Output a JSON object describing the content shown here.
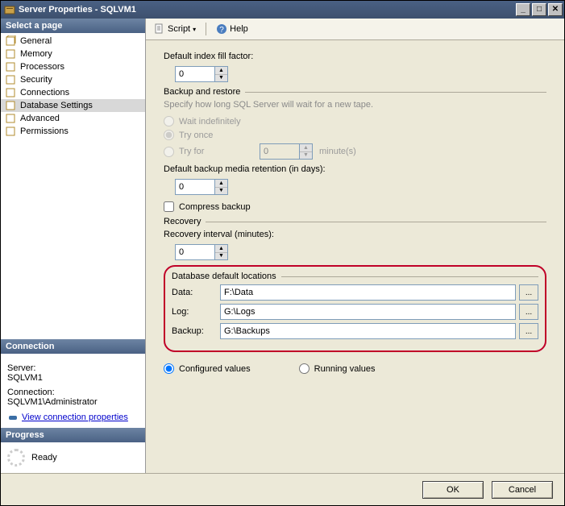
{
  "window": {
    "title": "Server Properties - SQLVM1"
  },
  "left": {
    "select_page_header": "Select a page",
    "pages": [
      {
        "label": "General",
        "selected": false
      },
      {
        "label": "Memory",
        "selected": false
      },
      {
        "label": "Processors",
        "selected": false
      },
      {
        "label": "Security",
        "selected": false
      },
      {
        "label": "Connections",
        "selected": false
      },
      {
        "label": "Database Settings",
        "selected": true
      },
      {
        "label": "Advanced",
        "selected": false
      },
      {
        "label": "Permissions",
        "selected": false
      }
    ],
    "connection_header": "Connection",
    "server_label": "Server:",
    "server_value": "SQLVM1",
    "connection_label": "Connection:",
    "connection_value": "SQLVM1\\Administrator",
    "view_conn_props": "View connection properties",
    "progress_header": "Progress",
    "progress_status": "Ready"
  },
  "toolbar": {
    "script": "Script",
    "help": "Help"
  },
  "content": {
    "fill_factor_label": "Default index fill factor:",
    "fill_factor_value": "0",
    "backup_restore_header": "Backup and restore",
    "backup_hint": "Specify how long SQL Server will wait for a new tape.",
    "radio_wait": "Wait indefinitely",
    "radio_try_once": "Try once",
    "radio_try_for": "Try for",
    "try_for_value": "0",
    "try_for_unit": "minute(s)",
    "retention_label": "Default backup media retention (in days):",
    "retention_value": "0",
    "compress_label": "Compress backup",
    "recovery_header": "Recovery",
    "recovery_interval_label": "Recovery interval (minutes):",
    "recovery_interval_value": "0",
    "db_locations_header": "Database default locations",
    "loc_data_label": "Data:",
    "loc_data_value": "F:\\Data",
    "loc_log_label": "Log:",
    "loc_log_value": "G:\\Logs",
    "loc_backup_label": "Backup:",
    "loc_backup_value": "G:\\Backups",
    "radio_configured": "Configured values",
    "radio_running": "Running values"
  },
  "footer": {
    "ok": "OK",
    "cancel": "Cancel"
  }
}
